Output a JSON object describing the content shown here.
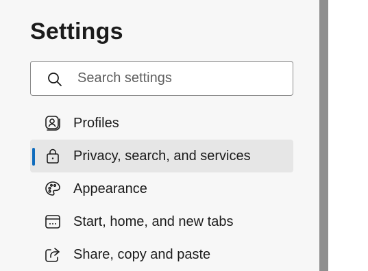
{
  "page": {
    "title": "Settings"
  },
  "search": {
    "placeholder": "Search settings",
    "icon": "search-icon"
  },
  "nav": {
    "items": [
      {
        "label": "Profiles",
        "icon": "profile-icon",
        "active": false
      },
      {
        "label": "Privacy, search, and services",
        "icon": "lock-icon",
        "active": true
      },
      {
        "label": "Appearance",
        "icon": "palette-icon",
        "active": false
      },
      {
        "label": "Start, home, and new tabs",
        "icon": "start-home-icon",
        "active": false
      },
      {
        "label": "Share, copy and paste",
        "icon": "share-icon",
        "active": false
      }
    ]
  },
  "colors": {
    "accent": "#0f6cbd",
    "background": "#f7f7f7",
    "active_item": "#e6e6e6",
    "divider": "#8f8f8f"
  }
}
